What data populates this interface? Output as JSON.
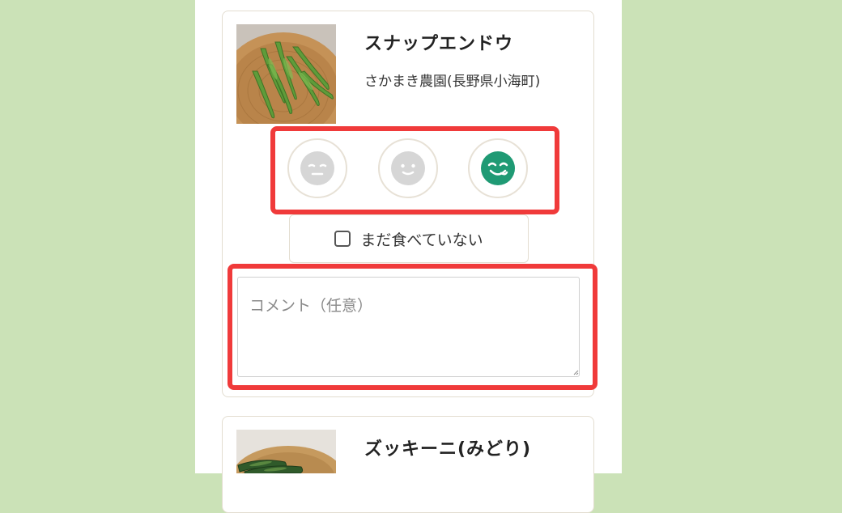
{
  "colors": {
    "page_background": "#cbe2b7",
    "highlight": "#f03a3a",
    "selected_face": "#1f9a74",
    "unselected_face": "#d6d6d6",
    "card_border": "#e3ddd0"
  },
  "items": [
    {
      "name": "スナップエンドウ",
      "farm": "さかまき農園(長野県小海町)",
      "photo_icon": "snap-pea-photo",
      "ratings": [
        {
          "icon": "dislike-face-icon",
          "selected": false
        },
        {
          "icon": "neutral-face-icon",
          "selected": false
        },
        {
          "icon": "delicious-face-icon",
          "selected": true
        }
      ],
      "not_eaten_label": "まだ食べていない",
      "not_eaten_checked": false,
      "comment_placeholder": "コメント（任意）",
      "comment_value": ""
    },
    {
      "name": "ズッキーニ(みどり)",
      "photo_icon": "zucchini-photo"
    }
  ]
}
